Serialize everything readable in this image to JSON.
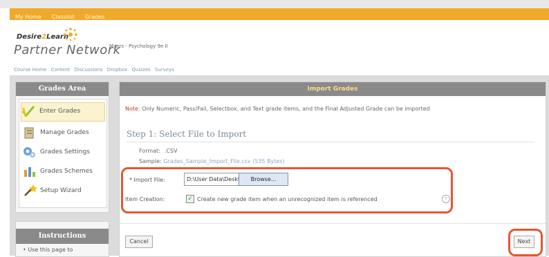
{
  "topnav": {
    "items": [
      "My Home",
      "Classlist",
      "Grades"
    ]
  },
  "header": {
    "logo_top_a": "Desire",
    "logo_top_b": "2",
    "logo_top_c": "Learn",
    "logo_main": "Partner Network",
    "course_name": "Myers - Psychology 9e II",
    "nav_links": [
      "Course Home",
      "Content",
      "Discussions",
      "Dropbox",
      "Quizzes",
      "Surveys"
    ]
  },
  "sidebar": {
    "title": "Grades Area",
    "items": [
      {
        "label": "Enter Grades",
        "icon": "pencil-check-icon",
        "active": true
      },
      {
        "label": "Manage Grades",
        "icon": "gradebook-icon"
      },
      {
        "label": "Grades Settings",
        "icon": "settings-gears-icon"
      },
      {
        "label": "Grades Schemes",
        "icon": "bar-chart-icon"
      },
      {
        "label": "Setup Wizard",
        "icon": "wand-icon"
      }
    ],
    "instructions_title": "Instructions",
    "instructions_text": "• Use this page to"
  },
  "main": {
    "title": "Import Grades",
    "note_label": "Note:",
    "note_text": "Only Numeric, Pass/Fail, Selectbox, and Text grade items, and the Final Adjusted Grade can be imported",
    "step_title": "Step 1: Select File to Import",
    "format_label": "Format:",
    "format_value": ".CSV",
    "sample_label": "Sample:",
    "sample_value": "Grades_Sample_Import_File.csv (535 Bytes)",
    "import_label": "* Import File:",
    "file_value": "D:\\User Data\\Desktop\\Upl",
    "browse_label": "Browse...",
    "item_creation_label": "Item Creation:",
    "item_creation_text": "Create new grade item when an unrecognized item is referenced",
    "item_creation_checked": true,
    "cancel_label": "Cancel",
    "next_label": "Next"
  },
  "colors": {
    "accent": "#f0a92b",
    "highlight": "#e4572e",
    "panel_header": "#8a8a8a"
  }
}
